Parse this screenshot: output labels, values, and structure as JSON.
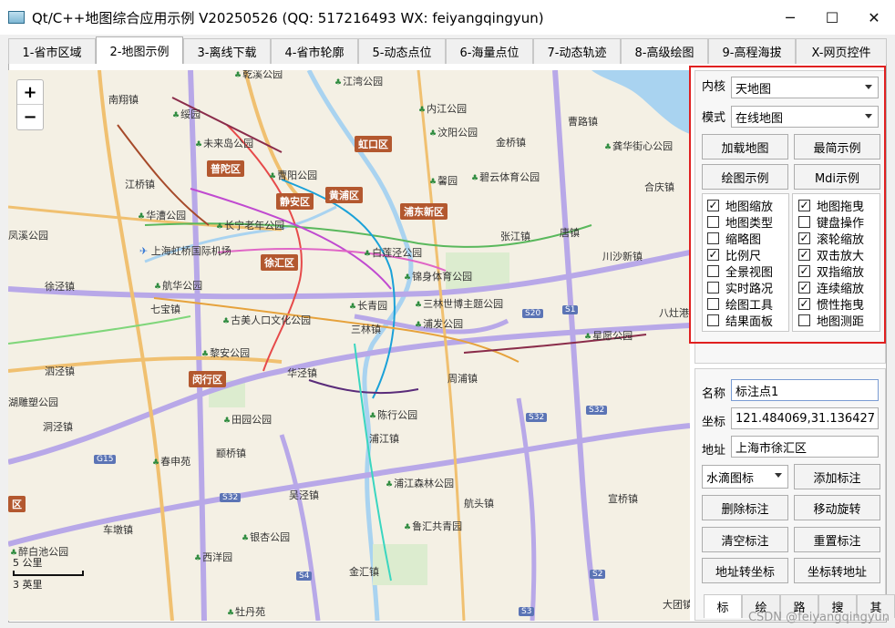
{
  "window": {
    "title": "Qt/C++地图综合应用示例 V20250526 (QQ: 517216493 WX: feiyangqingyun)",
    "min_glyph": "─",
    "max_glyph": "☐",
    "close_glyph": "✕"
  },
  "tabs": [
    {
      "label": "1-省市区域"
    },
    {
      "label": "2-地图示例"
    },
    {
      "label": "3-离线下载"
    },
    {
      "label": "4-省市轮廓"
    },
    {
      "label": "5-动态点位"
    },
    {
      "label": "6-海量点位"
    },
    {
      "label": "7-动态轨迹"
    },
    {
      "label": "8-高级绘图"
    },
    {
      "label": "9-高程海拔"
    },
    {
      "label": "X-网页控件"
    }
  ],
  "active_tab": 1,
  "map": {
    "zoom_in": "+",
    "zoom_out": "−",
    "scale_top": "5 公里",
    "scale_bottom": "3 英里",
    "districts": [
      "普陀区",
      "虹口区",
      "静安区",
      "黄浦区",
      "浦东新区",
      "徐汇区",
      "闵行区",
      "区"
    ],
    "places": [
      "江湾公园",
      "乾溪公园",
      "南翔镇",
      "嘉定镇",
      "绥园",
      "内江公园",
      "曹路镇",
      "未来岛公园",
      "汶阳公园",
      "金桥镇",
      "龚华街心公园",
      "江桥镇",
      "曹阳公园",
      "馨园",
      "碧云体育公园",
      "合庆镇",
      "华漕公园",
      "长宁老年公园",
      "凤溪公园",
      "上海虹桥国际机场",
      "白莲泾公园",
      "张江镇",
      "唐镇",
      "川沙新镇",
      "徐泾镇",
      "航华公园",
      "锦身体育公园",
      "七宝镇",
      "长青园",
      "三林世博主题公园",
      "古美人口文化公园",
      "浦发公园",
      "三林镇",
      "星愿公园",
      "黎安公园",
      "泗泾镇",
      "华泾镇",
      "周浦镇",
      "湖雕塑公园",
      "洞泾镇",
      "田园公园",
      "陈行公园",
      "浦江镇",
      "颛桥镇",
      "春申苑",
      "浦江森林公园",
      "航头镇",
      "吴泾镇",
      "宣桥镇",
      "车墩镇",
      "银杏公园",
      "鲁汇共青园",
      "醉白池公园",
      "西洋园",
      "金汇镇",
      "牡丹苑",
      "大团镇",
      "八灶港"
    ],
    "road_signs": [
      "S20",
      "S1",
      "S32",
      "S32",
      "S32",
      "G15",
      "S4",
      "S2",
      "S3"
    ]
  },
  "panel": {
    "kernel_label": "内核",
    "kernel_value": "天地图",
    "mode_label": "模式",
    "mode_value": "在线地图",
    "buttons_top": [
      "加载地图",
      "最简示例",
      "绘图示例",
      "Mdi示例"
    ],
    "checks_left": [
      {
        "label": "地图缩放",
        "checked": true
      },
      {
        "label": "地图类型",
        "checked": false
      },
      {
        "label": "缩略图",
        "checked": false
      },
      {
        "label": "比例尺",
        "checked": true
      },
      {
        "label": "全景视图",
        "checked": false
      },
      {
        "label": "实时路况",
        "checked": false
      },
      {
        "label": "绘图工具",
        "checked": false
      },
      {
        "label": "结果面板",
        "checked": false
      }
    ],
    "checks_right": [
      {
        "label": "地图拖曳",
        "checked": true
      },
      {
        "label": "键盘操作",
        "checked": false
      },
      {
        "label": "滚轮缩放",
        "checked": true
      },
      {
        "label": "双击放大",
        "checked": true
      },
      {
        "label": "双指缩放",
        "checked": true
      },
      {
        "label": "连续缩放",
        "checked": true
      },
      {
        "label": "惯性拖曳",
        "checked": true
      },
      {
        "label": "地图测距",
        "checked": false
      }
    ],
    "name_label": "名称",
    "name_value": "标注点1",
    "coord_label": "坐标",
    "coord_value": "121.484069,31.136427",
    "addr_label": "地址",
    "addr_value": "上海市徐汇区",
    "icon_combo": "水滴图标",
    "buttons_bottom": [
      "添加标注",
      "删除标注",
      "移动旋转",
      "清空标注",
      "重置标注",
      "地址转坐标",
      "坐标转地址"
    ],
    "subtabs": [
      "标",
      "绘",
      "路",
      "搜",
      "其"
    ]
  },
  "watermark": "CSDN @feiyangqingyun",
  "colors": {
    "highlight": "#e02020",
    "district": "#b3582f",
    "road": "#b8a8e8",
    "water": "#a9d3f0",
    "park": "#2e8b3e"
  }
}
